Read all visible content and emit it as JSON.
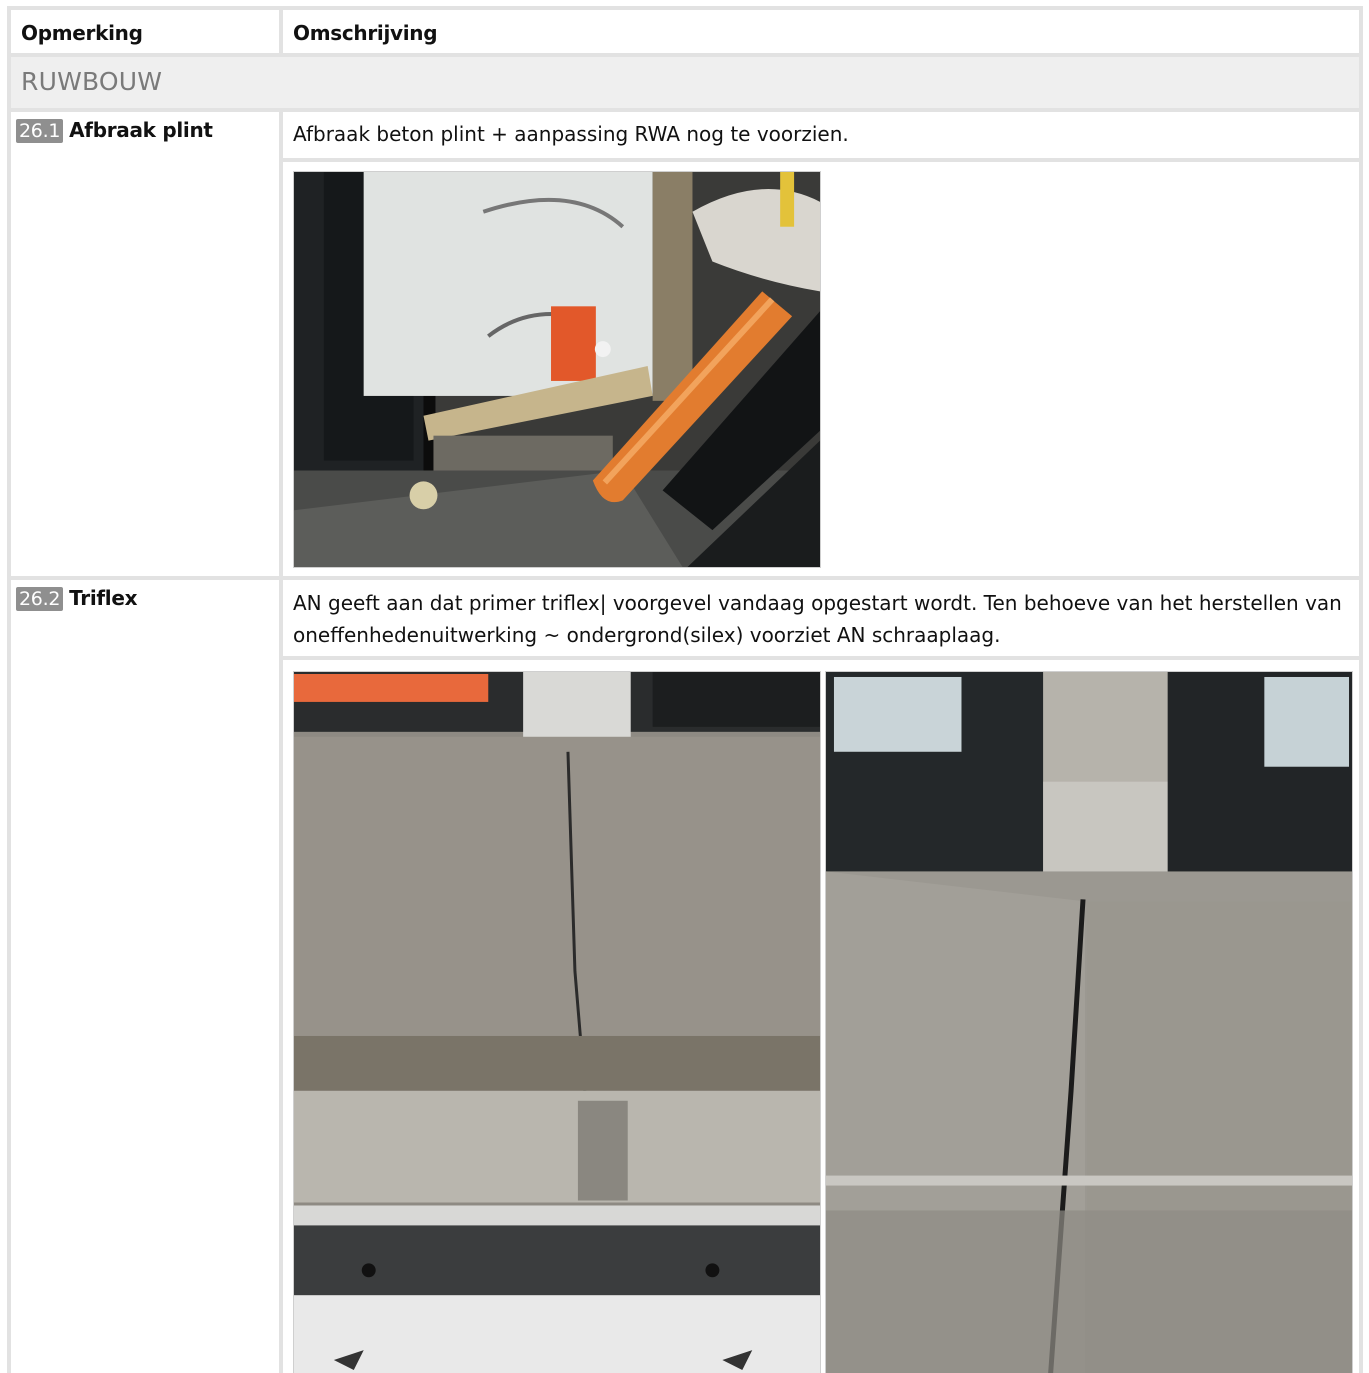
{
  "table": {
    "col1_header": "Opmerking",
    "col2_header": "Omschrijving"
  },
  "section": {
    "title": "RUWBOUW"
  },
  "items": [
    {
      "number": "26.1",
      "title": "Afbraak plint",
      "description": "Afbraak beton plint + aanpassing RWA nog te voorzien.",
      "photos": [
        "photo-wall-insulation-orange-pipe"
      ]
    },
    {
      "number": "26.2",
      "title": "Triflex",
      "description": "AN geeft aan dat primer triflex| voorgevel vandaag opgestart wordt. Ten behoeve van het herstellen van oneffenhedenuitwerking ~ ondergrond(silex) voorziet AN schraaplaag.",
      "photos": [
        "photo-concrete-slab-joint",
        "photo-concrete-slab-crack-doors"
      ]
    }
  ]
}
